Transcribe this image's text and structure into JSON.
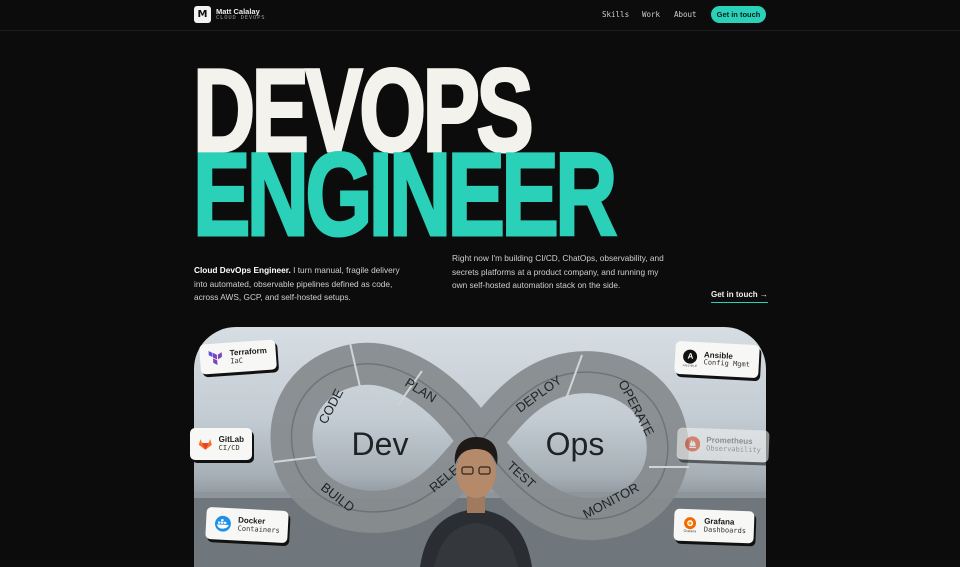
{
  "nav": {
    "logo_letter": "M",
    "brand_name": "Matt Calalay",
    "brand_sub": "CLOUD DEVOPS",
    "links": [
      "Skills",
      "Work",
      "About"
    ],
    "cta": "Get in touch"
  },
  "hero": {
    "line1": "DEVOPS",
    "line2": "ENGINEER"
  },
  "intro": {
    "lead_bold": "Cloud DevOps Engineer.",
    "lead_rest": " I turn manual, fragile delivery into automated, observable pipelines defined as code, across AWS, GCP, and self-hosted setups.",
    "right": "Right now I'm building CI/CD, ChatOps, observability, and secrets platforms at a product company, and running my own self-hosted automation stack on the side.",
    "cta": "Get in touch →"
  },
  "loop": {
    "dev": "Dev",
    "ops": "Ops",
    "stages": [
      "CODE",
      "PLAN",
      "BUILD",
      "RELEASE",
      "TEST",
      "DEPLOY",
      "OPERATE",
      "MONITOR"
    ]
  },
  "badges": [
    {
      "name": "Terraform",
      "role": "IaC",
      "icon": "terraform-icon"
    },
    {
      "name": "GitLab",
      "role": "CI/CD",
      "icon": "gitlab-icon"
    },
    {
      "name": "Docker",
      "role": "Containers",
      "icon": "docker-icon"
    },
    {
      "name": "Ansible",
      "role": "Config Mgmt",
      "icon": "ansible-icon",
      "icon_letter": "A",
      "icon_caption": "ANSIBLE"
    },
    {
      "name": "Prometheus",
      "role": "Observability",
      "icon": "prometheus-icon"
    },
    {
      "name": "Grafana",
      "role": "Dashboards",
      "icon": "grafana-icon",
      "icon_caption": "Grafana"
    }
  ],
  "colors": {
    "background": "#0c0c0c",
    "accent": "#2ad0b8",
    "hero_light": "#f4f2ec"
  }
}
